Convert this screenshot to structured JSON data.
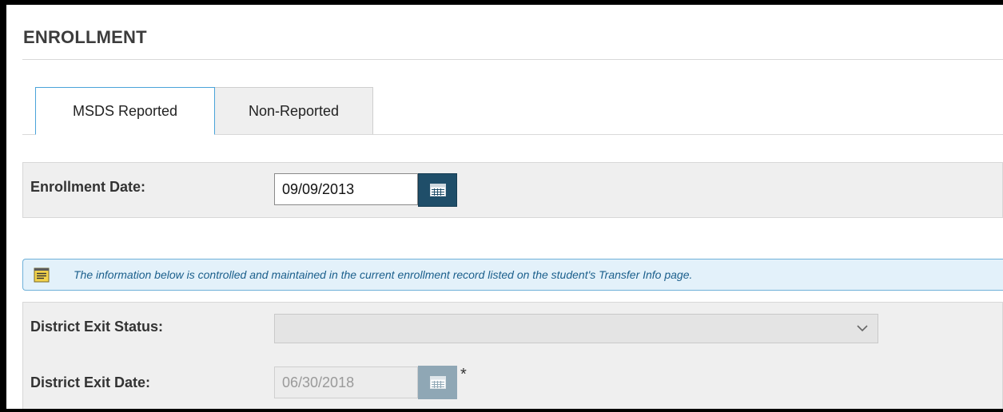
{
  "section_title": "ENROLLMENT",
  "tabs": [
    {
      "label": "MSDS Reported",
      "active": true
    },
    {
      "label": "Non-Reported",
      "active": false
    }
  ],
  "enrollment_date": {
    "label": "Enrollment Date:",
    "value": "09/09/2013",
    "icon": "calendar-icon"
  },
  "info_banner": {
    "icon": "note-icon",
    "text": "The information below is controlled and maintained in the current enrollment record listed on the student's Transfer Info page."
  },
  "district_exit_status": {
    "label": "District Exit Status:",
    "value": "",
    "icon": "chevron-down-icon"
  },
  "district_exit_date": {
    "label": "District Exit Date:",
    "value": "06/30/2018",
    "icon": "calendar-icon",
    "required_mark": "*"
  },
  "colors": {
    "accent_border": "#4aa3d9",
    "calendar_button": "#1f4e69",
    "banner_bg": "#e3f1fa",
    "banner_text": "#1b5f8c"
  }
}
